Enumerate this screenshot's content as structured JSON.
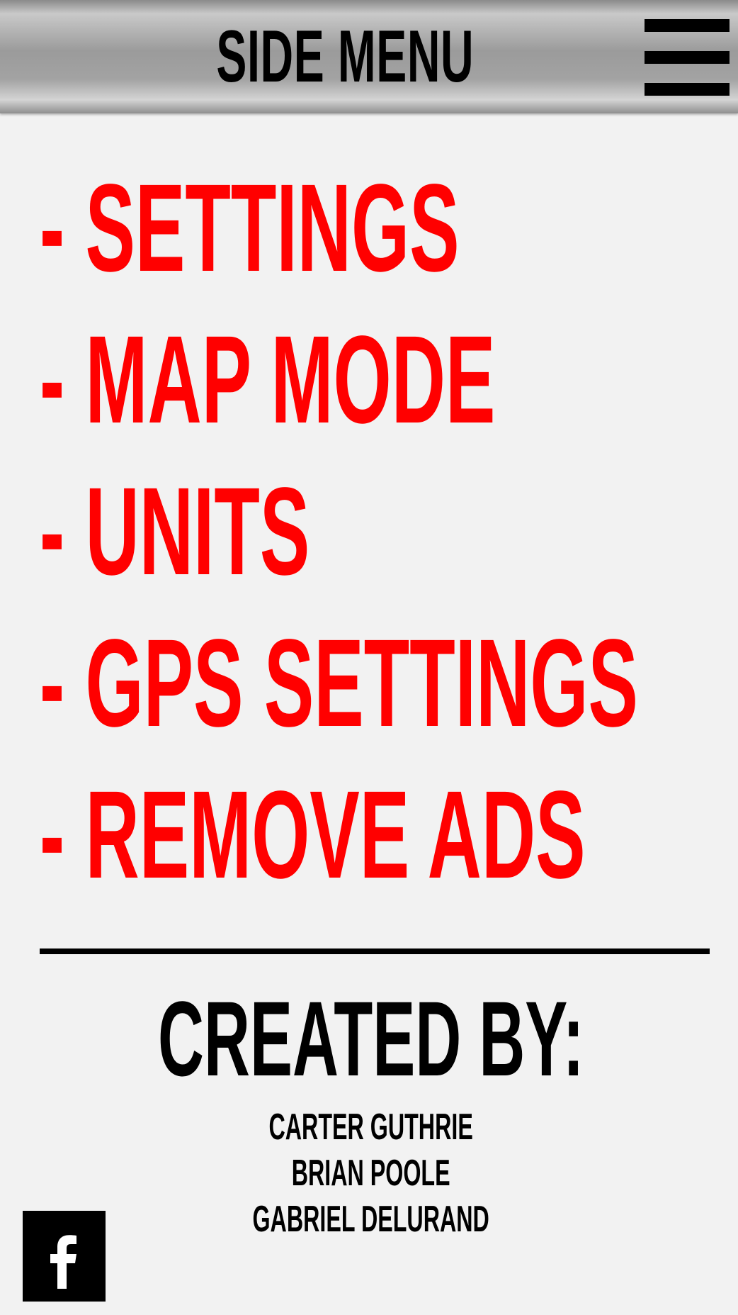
{
  "header": {
    "title": "SIDE MENU",
    "menu_icon": "hamburger-icon"
  },
  "menu": {
    "items": [
      {
        "label": "- SETTINGS"
      },
      {
        "label": "- MAP MODE"
      },
      {
        "label": "- UNITS"
      },
      {
        "label": "- GPS SETTINGS"
      },
      {
        "label": "- REMOVE ADS"
      }
    ],
    "color": "#ff0000"
  },
  "credits": {
    "title": "CREATED BY:",
    "names": [
      "CARTER GUTHRIE",
      "BRIAN POOLE",
      "GABRIEL DELURAND"
    ]
  },
  "social": {
    "icon": "facebook-icon"
  }
}
